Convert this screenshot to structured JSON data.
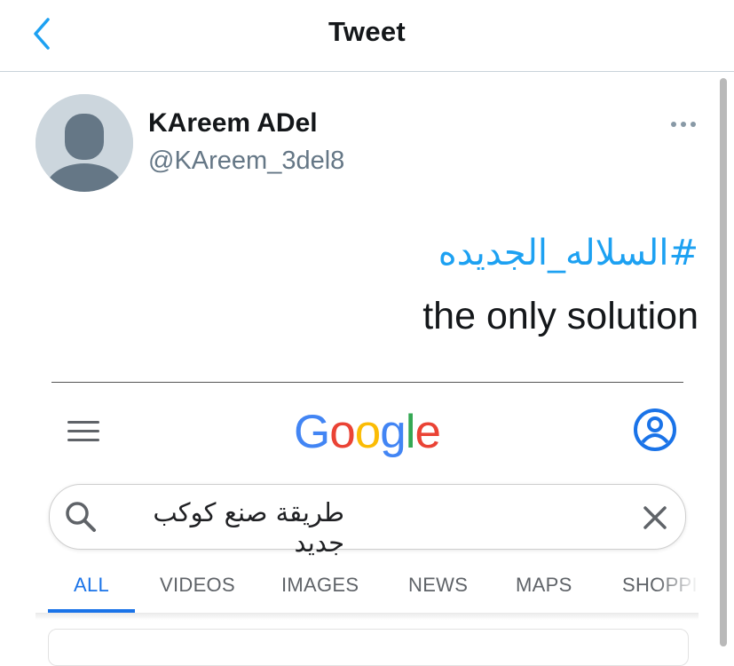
{
  "header": {
    "title": "Tweet",
    "back_icon": "chevron-left-icon"
  },
  "tweet": {
    "author_name": "KAreem ADel",
    "author_handle": "@KAreem_3del8",
    "hashtag": "#السلاله_الجديده",
    "text": "the only solution",
    "more_icon": "more-horizontal-icon"
  },
  "embedded": {
    "logo": {
      "letters": [
        "G",
        "o",
        "o",
        "g",
        "l",
        "e"
      ],
      "colors": [
        "#4285F4",
        "#EA4335",
        "#FBBC05",
        "#4285F4",
        "#34A853",
        "#EA4335"
      ]
    },
    "search": {
      "query": "طريقة صنع كوكب جديد"
    },
    "tabs": [
      {
        "label": "ALL",
        "active": true
      },
      {
        "label": "VIDEOS",
        "active": false
      },
      {
        "label": "IMAGES",
        "active": false
      },
      {
        "label": "NEWS",
        "active": false
      },
      {
        "label": "MAPS",
        "active": false
      },
      {
        "label": "SHOPPI",
        "active": false
      }
    ]
  },
  "colors": {
    "twitter_blue": "#1da1f2",
    "google_blue": "#1a73e8",
    "handle_gray": "#657786"
  }
}
